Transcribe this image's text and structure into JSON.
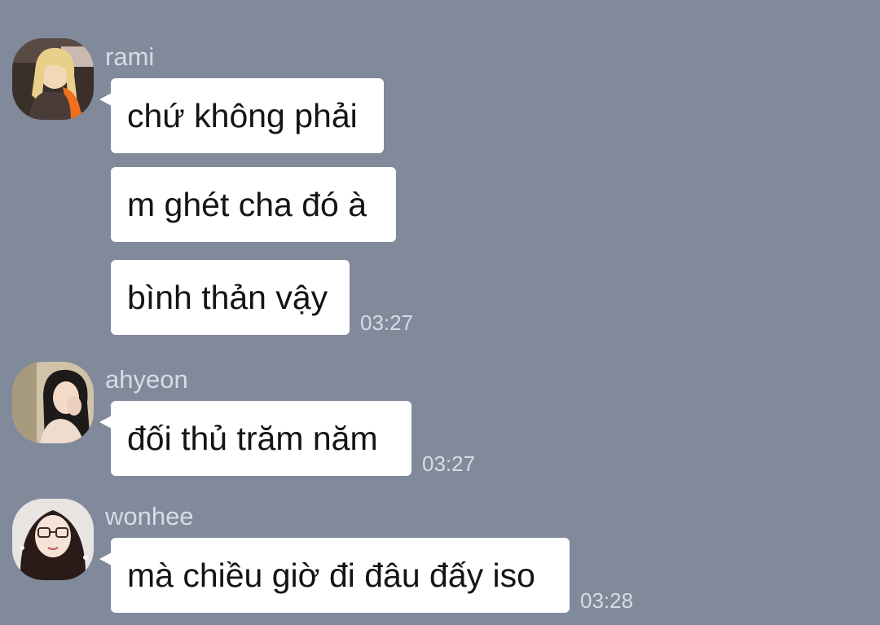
{
  "messages": [
    {
      "sender": "rami",
      "avatar_icon": "user-avatar-rami",
      "bubbles": [
        "chứ không phải",
        "m ghét cha đó à",
        "bình thản vậy"
      ],
      "time": "03:27"
    },
    {
      "sender": "ahyeon",
      "avatar_icon": "user-avatar-ahyeon",
      "bubbles": [
        "đối thủ trăm năm"
      ],
      "time": "03:27"
    },
    {
      "sender": "wonhee",
      "avatar_icon": "user-avatar-wonhee",
      "bubbles": [
        "mà chiều giờ đi đâu đấy iso"
      ],
      "time": "03:28"
    }
  ],
  "colors": {
    "background": "#808a9b",
    "bubble": "#ffffff",
    "meta_text": "#d7dce4",
    "message_text": "#141414"
  }
}
